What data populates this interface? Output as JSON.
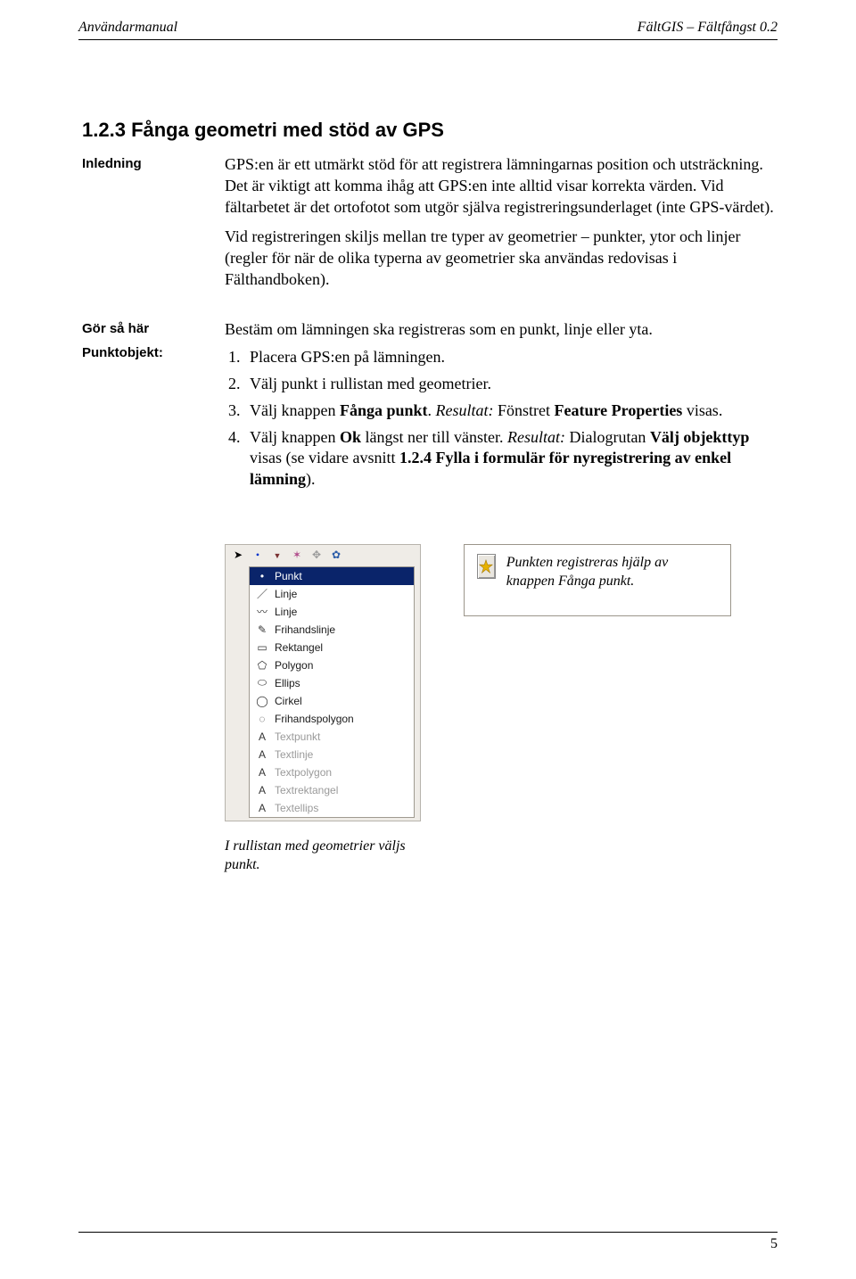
{
  "header": {
    "left": "Användarmanual",
    "right": "FältGIS – Fältfångst 0.2"
  },
  "section": {
    "number": "1.2.3",
    "title": "Fånga geometri med stöd av GPS"
  },
  "inledning": {
    "label": "Inledning",
    "p1": "GPS:en är ett utmärkt stöd för att registrera lämningarnas position och utsträckning. Det är viktigt att komma ihåg att GPS:en inte alltid visar korrekta värden. Vid fältarbetet är det ortofotot som utgör själva registreringsunderlaget (inte GPS-värdet).",
    "p2": "Vid registreringen skiljs mellan tre typer av geometrier – punkter, ytor och linjer (regler för när de olika typerna av geometrier ska användas redovisas i Fälthandboken)."
  },
  "gorsahar": {
    "label": "Gör så här",
    "text": "Bestäm om lämningen ska registreras som en punkt, linje eller yta."
  },
  "punktobjekt": {
    "label": "Punktobjekt:",
    "step1": "Placera GPS:en på lämningen.",
    "step2": "Välj punkt i rullistan med geometrier.",
    "step3_a": "Välj knappen ",
    "step3_b": "Fånga punkt",
    "step3_c": ". ",
    "step3_d": "Resultat:",
    "step3_e": " Fönstret ",
    "step3_f": "Feature Properties",
    "step3_g": " visas.",
    "step4_a": "Välj knappen ",
    "step4_b": "Ok",
    "step4_c": " längst ner till vänster. ",
    "step4_d": "Resultat:",
    "step4_e": " Dialogrutan ",
    "step4_f": "Välj objekttyp",
    "step4_g": " visas (se vidare avsnitt ",
    "step4_h": "1.2.4 Fylla i formulär för nyregistrering av enkel lämning",
    "step4_i": ")."
  },
  "dropdown": {
    "items": [
      {
        "label": "Punkt",
        "icon": "•",
        "selected": true,
        "disabled": false
      },
      {
        "label": "Linje",
        "icon": "／",
        "selected": false,
        "disabled": false
      },
      {
        "label": "Linje",
        "icon": "〰",
        "selected": false,
        "disabled": false
      },
      {
        "label": "Frihandslinje",
        "icon": "✎",
        "selected": false,
        "disabled": false
      },
      {
        "label": "Rektangel",
        "icon": "▭",
        "selected": false,
        "disabled": false
      },
      {
        "label": "Polygon",
        "icon": "⬠",
        "selected": false,
        "disabled": false
      },
      {
        "label": "Ellips",
        "icon": "⬭",
        "selected": false,
        "disabled": false
      },
      {
        "label": "Cirkel",
        "icon": "◯",
        "selected": false,
        "disabled": false
      },
      {
        "label": "Frihandspolygon",
        "icon": "◌",
        "selected": false,
        "disabled": false
      },
      {
        "label": "Textpunkt",
        "icon": "A",
        "selected": false,
        "disabled": true
      },
      {
        "label": "Textlinje",
        "icon": "A",
        "selected": false,
        "disabled": true
      },
      {
        "label": "Textpolygon",
        "icon": "A",
        "selected": false,
        "disabled": true
      },
      {
        "label": "Textrektangel",
        "icon": "A",
        "selected": false,
        "disabled": true
      },
      {
        "label": "Textellips",
        "icon": "A",
        "selected": false,
        "disabled": true
      }
    ]
  },
  "figcaptions": {
    "left": "I rullistan med geometrier väljs punkt.",
    "right": "Punkten registreras hjälp av knappen Fånga punkt."
  },
  "page_number": "5"
}
